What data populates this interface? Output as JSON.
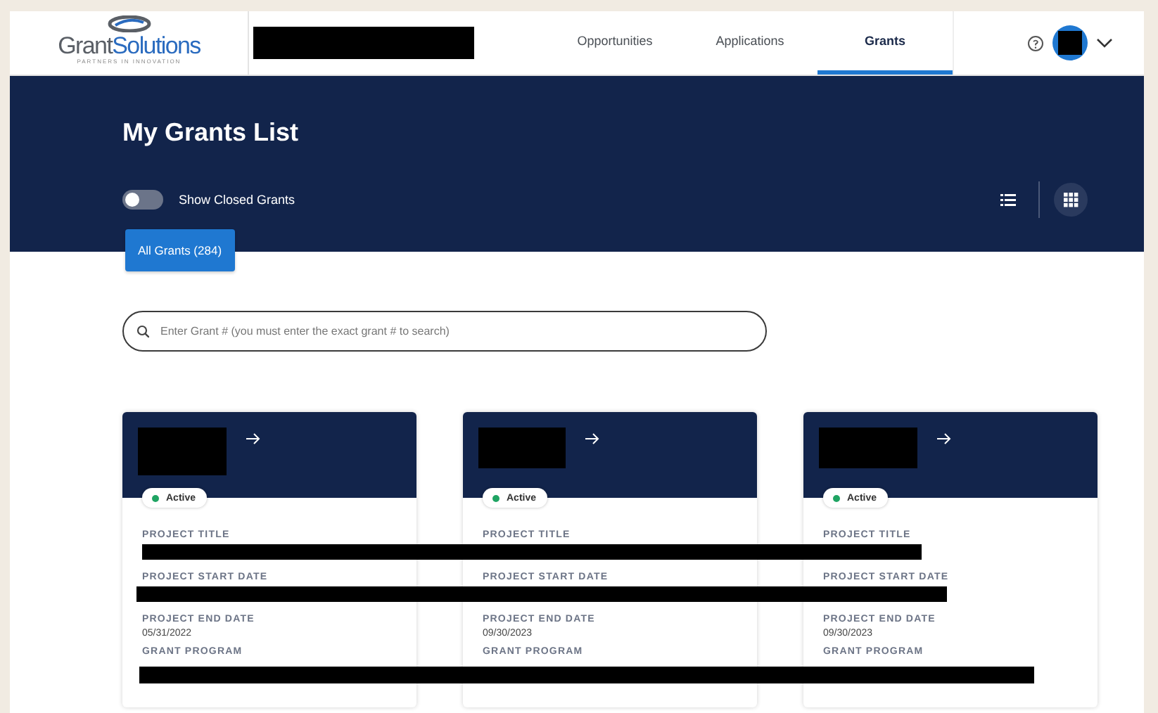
{
  "logo": {
    "text_1": "Grant",
    "text_2": "Solutions",
    "tagline": "PARTNERS IN INNOVATION"
  },
  "nav": [
    {
      "label": "Opportunities",
      "selected": false
    },
    {
      "label": "Applications",
      "selected": false
    },
    {
      "label": "Grants",
      "selected": true
    }
  ],
  "banner": {
    "title": "My Grants List",
    "toggle": {
      "label": "Show Closed Grants",
      "on": false
    },
    "views": [
      {
        "kind": "list",
        "selected": false
      },
      {
        "kind": "grid",
        "selected": true
      }
    ]
  },
  "tabs": [
    {
      "label": "All Grants (284)",
      "selected": true
    }
  ],
  "search": {
    "placeholder": "Enter Grant # (you must enter the exact grant # to search)"
  },
  "cards": [
    {
      "status": {
        "label": "Active",
        "color": "#1fa463"
      },
      "fields": [
        {
          "label": "PROJECT TITLE"
        },
        {
          "label": "PROJECT START DATE"
        },
        {
          "label": "PROJECT END DATE",
          "value": "05/31/2022"
        },
        {
          "label": "GRANT PROGRAM"
        }
      ]
    },
    {
      "status": {
        "label": "Active",
        "color": "#1fa463"
      },
      "fields": [
        {
          "label": "PROJECT TITLE"
        },
        {
          "label": "PROJECT START DATE"
        },
        {
          "label": "PROJECT END DATE",
          "value": "09/30/2023"
        },
        {
          "label": "GRANT PROGRAM"
        }
      ]
    },
    {
      "status": {
        "label": "Active",
        "color": "#1fa463"
      },
      "fields": [
        {
          "label": "PROJECT TITLE"
        },
        {
          "label": "PROJECT START DATE"
        },
        {
          "label": "PROJECT END DATE",
          "value": "09/30/2023"
        },
        {
          "label": "GRANT PROGRAM"
        }
      ]
    }
  ]
}
